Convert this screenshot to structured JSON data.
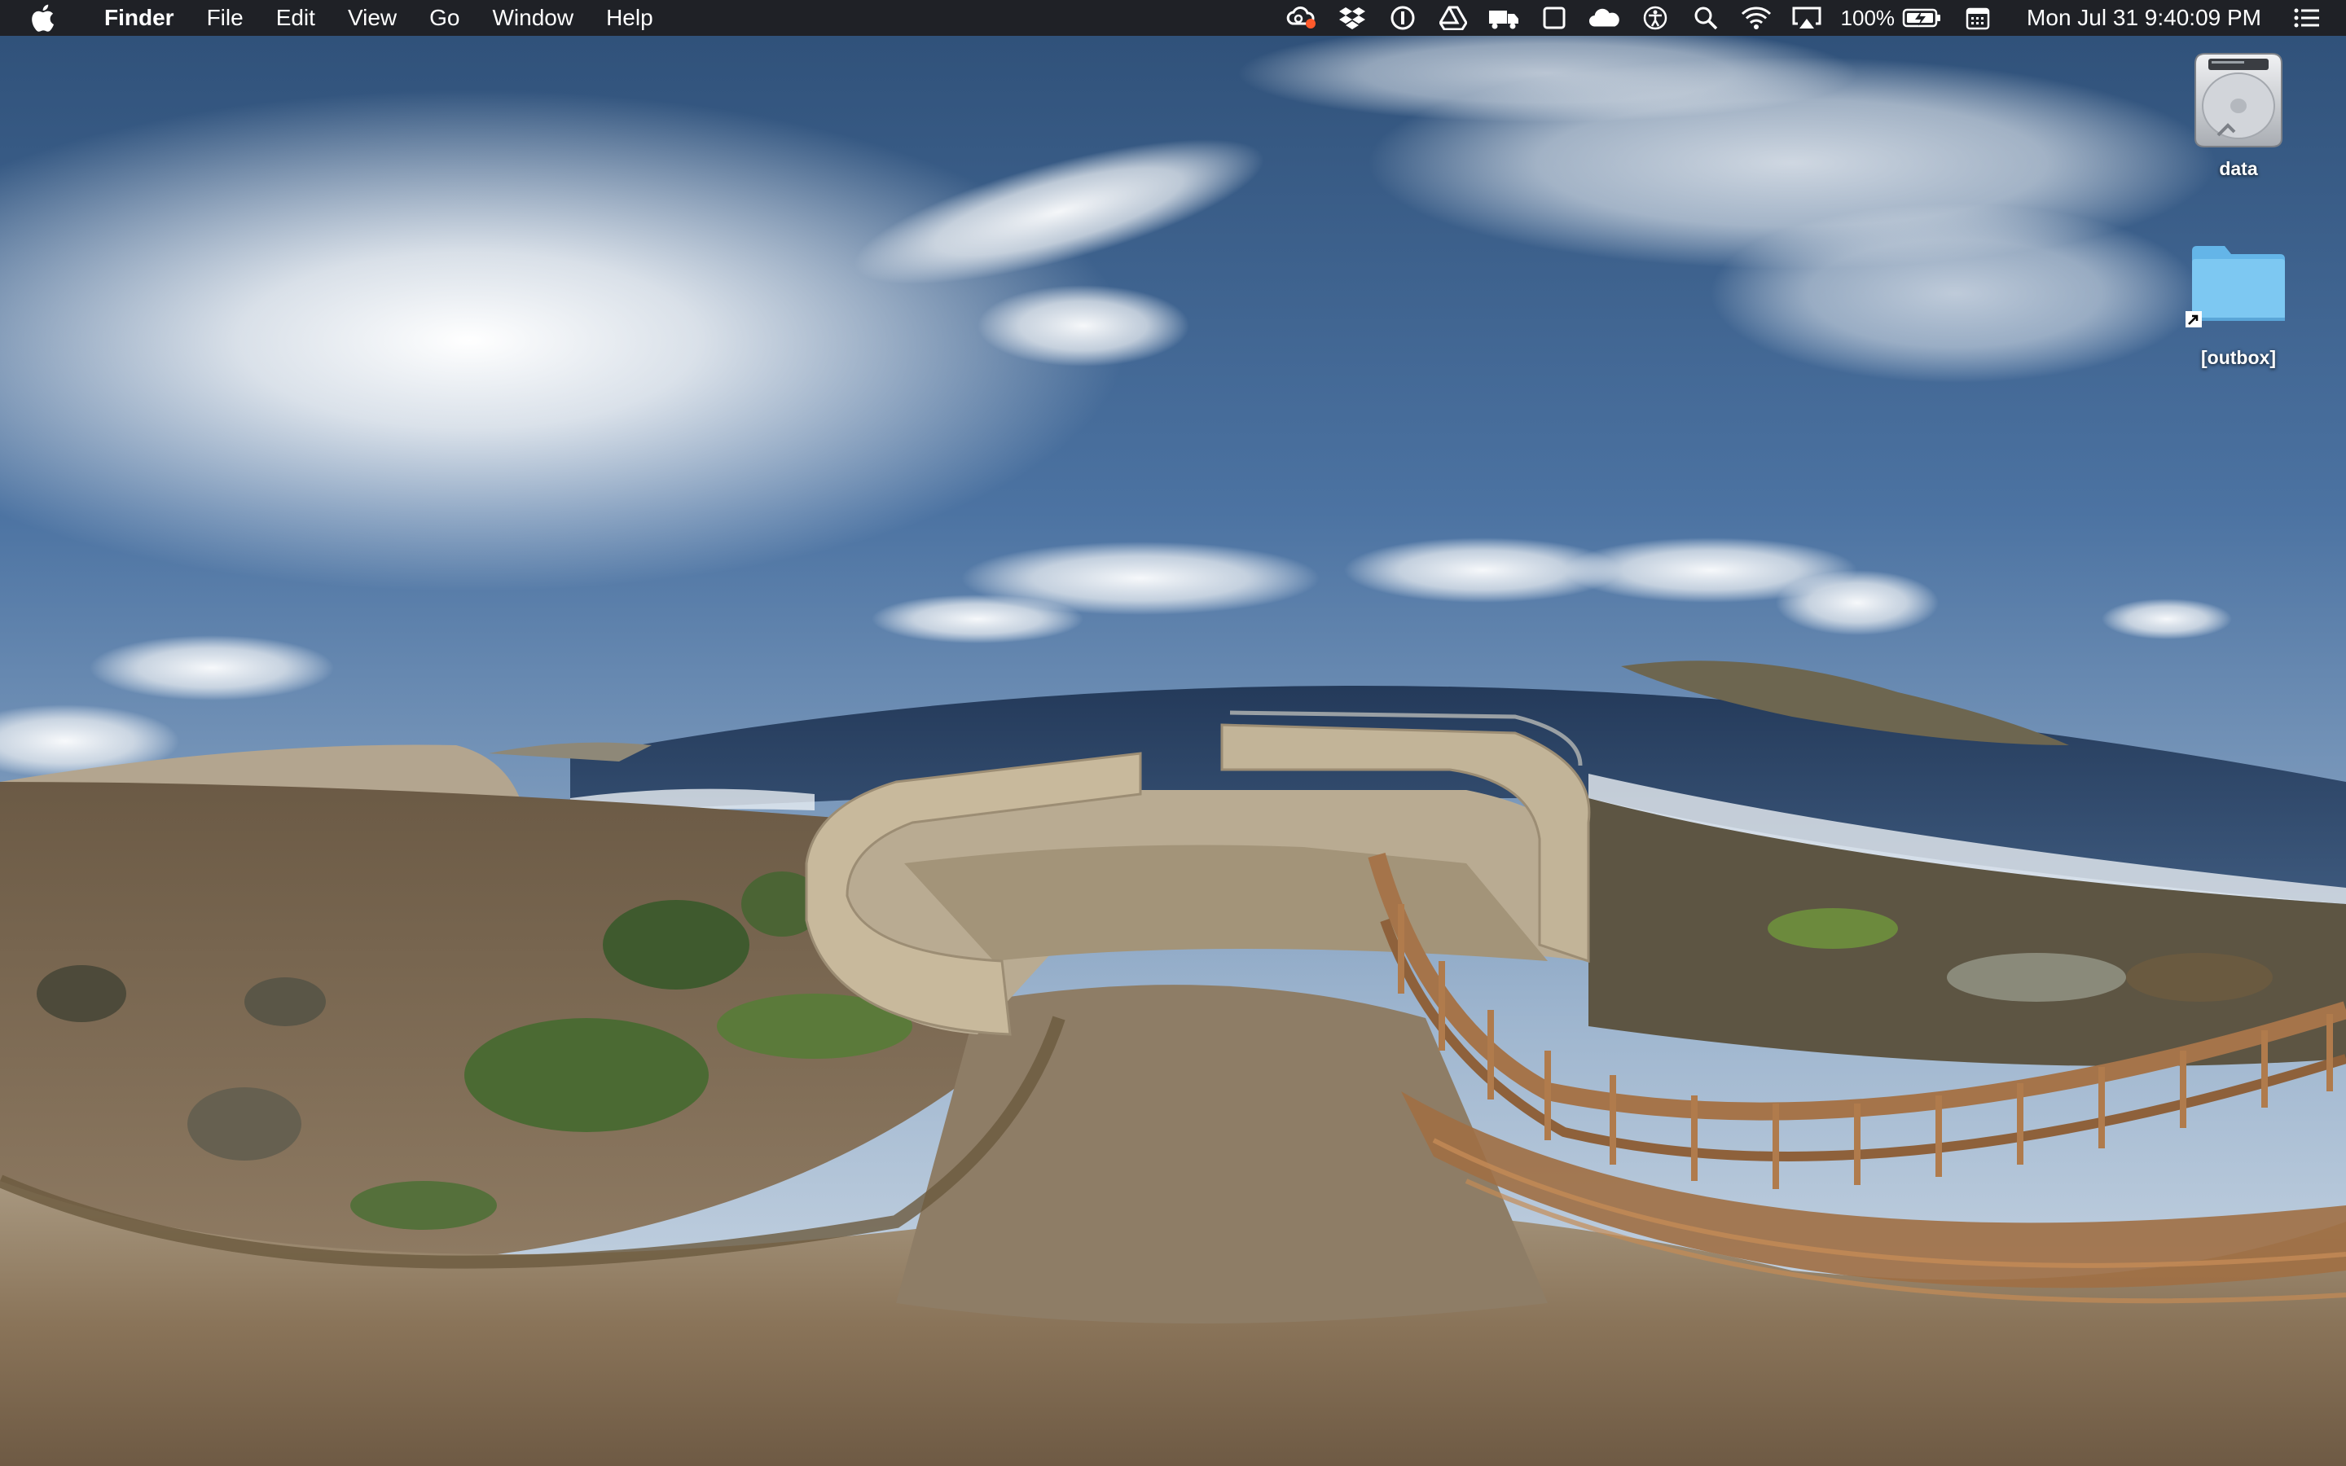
{
  "menubar": {
    "app_name": "Finder",
    "menus": [
      "File",
      "Edit",
      "View",
      "Go",
      "Window",
      "Help"
    ],
    "tray_icons": [
      "creative-cloud-icon",
      "dropbox-icon",
      "1password-icon",
      "google-drive-icon",
      "transmit-truck-icon",
      "window-square-icon",
      "cloud-app-icon",
      "accessibility-icon",
      "spotlight-search-icon",
      "wifi-icon",
      "airplay-icon"
    ],
    "battery_percent": "100%",
    "battery_charging": true,
    "calendar_icon": "menu-calendar-icon",
    "clock": "Mon Jul 31  9:40:09 PM",
    "notification_icon": "notification-center-icon",
    "colors": {
      "background": "#1f2126",
      "text": "#ffffff",
      "alert_dot": "#ff5a2b"
    }
  },
  "desktop": {
    "icons": [
      {
        "label": "data",
        "type": "hard-drive"
      },
      {
        "label": "[outbox]",
        "type": "folder-alias"
      }
    ],
    "wallpaper": "panoramic-coastal-lookout-fisheye"
  }
}
